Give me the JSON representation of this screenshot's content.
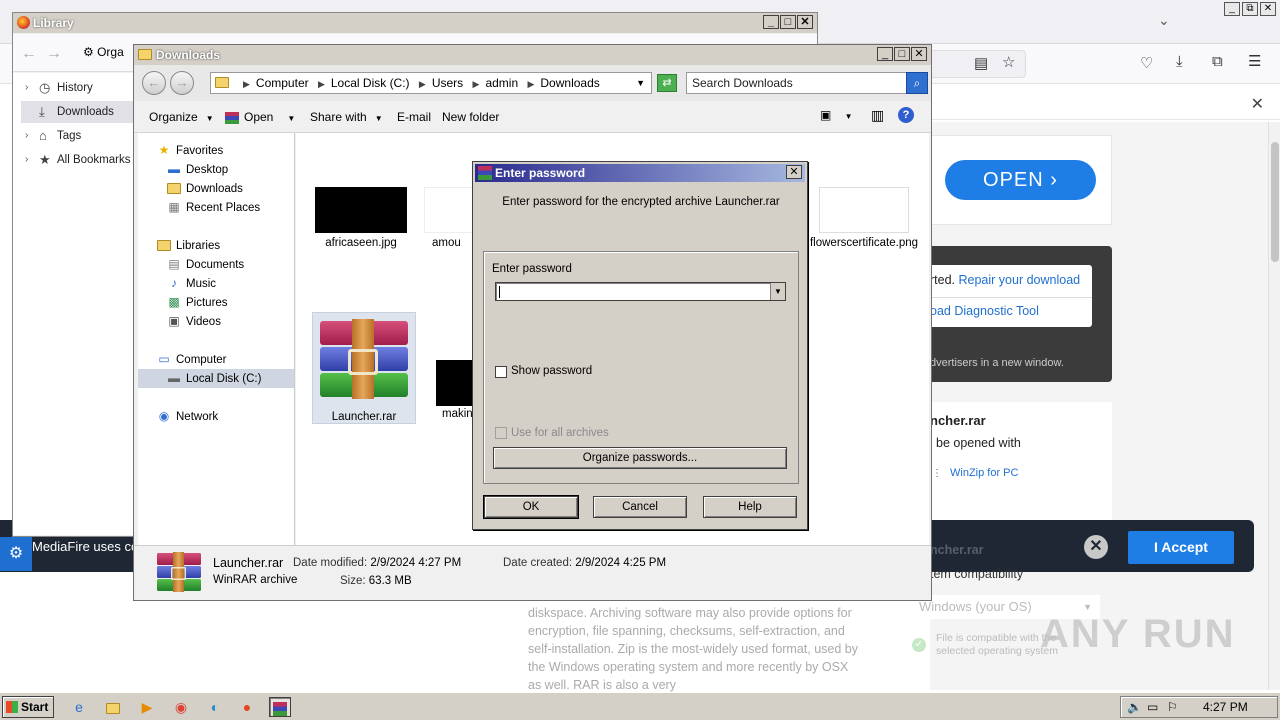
{
  "firefox": {
    "page": {
      "open_button": "OPEN",
      "repair_text_a": "rted. ",
      "repair_link": "Repair your download",
      "diagnostic_link": "oad Diagnostic Tool",
      "advertisers": "dvertisers in a new window.",
      "file_name": "ncher.rar",
      "opened_with": "be opened with",
      "winzip": "WinZip for PC",
      "cookie_text": "MediaFire uses co",
      "accept": "I Accept",
      "compat_label": "tem compatibility",
      "os_select": "Windows (your OS)",
      "compat_info": "File is compatible with the selected operating system",
      "paragraph": "diskspace. Archiving software may also provide options for encryption, file spanning, checksums, self-extraction, and self-installation. Zip is the most-widely used format, used by the Windows operating system and more recently by OSX as well. RAR is also a very",
      "faded_title": "ncher.rar",
      "watermark": "ANY RUN"
    }
  },
  "library": {
    "title": "Library",
    "organize": "Orga",
    "items": [
      {
        "label": "History",
        "icon": "clock-icon"
      },
      {
        "label": "Downloads",
        "icon": "download-icon"
      },
      {
        "label": "Tags",
        "icon": "tag-icon"
      },
      {
        "label": "All Bookmarks",
        "icon": "star-icon"
      }
    ]
  },
  "explorer": {
    "title": "Downloads",
    "breadcrumb": [
      "Computer",
      "Local Disk (C:)",
      "Users",
      "admin",
      "Downloads"
    ],
    "search_placeholder": "Search Downloads",
    "commands": {
      "organize": "Organize",
      "open": "Open",
      "share_with": "Share with",
      "email": "E-mail",
      "new_folder": "New folder"
    },
    "nav": {
      "favorites": "Favorites",
      "desktop": "Desktop",
      "downloads": "Downloads",
      "recent": "Recent Places",
      "libraries": "Libraries",
      "documents": "Documents",
      "music": "Music",
      "pictures": "Pictures",
      "videos": "Videos",
      "computer": "Computer",
      "local_disk": "Local Disk (C:)",
      "network": "Network"
    },
    "files": {
      "f1": "africaseen.jpg",
      "f2": "amou",
      "f3": "flowerscertificate.png",
      "f4": "Launcher.rar",
      "f5": "makin"
    },
    "status": {
      "name": "Launcher.rar",
      "type": "WinRAR archive",
      "modified_label": "Date modified:",
      "modified": "2/9/2024 4:27 PM",
      "size_label": "Size:",
      "size": "63.3 MB",
      "created_label": "Date created:",
      "created": "2/9/2024 4:25 PM"
    }
  },
  "dialog": {
    "title": "Enter password",
    "message": "Enter password for the encrypted archive Launcher.rar",
    "input_label": "Enter password",
    "input_value": "",
    "show_password": "Show password",
    "use_all": "Use for all archives",
    "organize": "Organize passwords...",
    "ok": "OK",
    "cancel": "Cancel",
    "help": "Help"
  },
  "taskbar": {
    "start": "Start",
    "clock": "4:27 PM"
  }
}
